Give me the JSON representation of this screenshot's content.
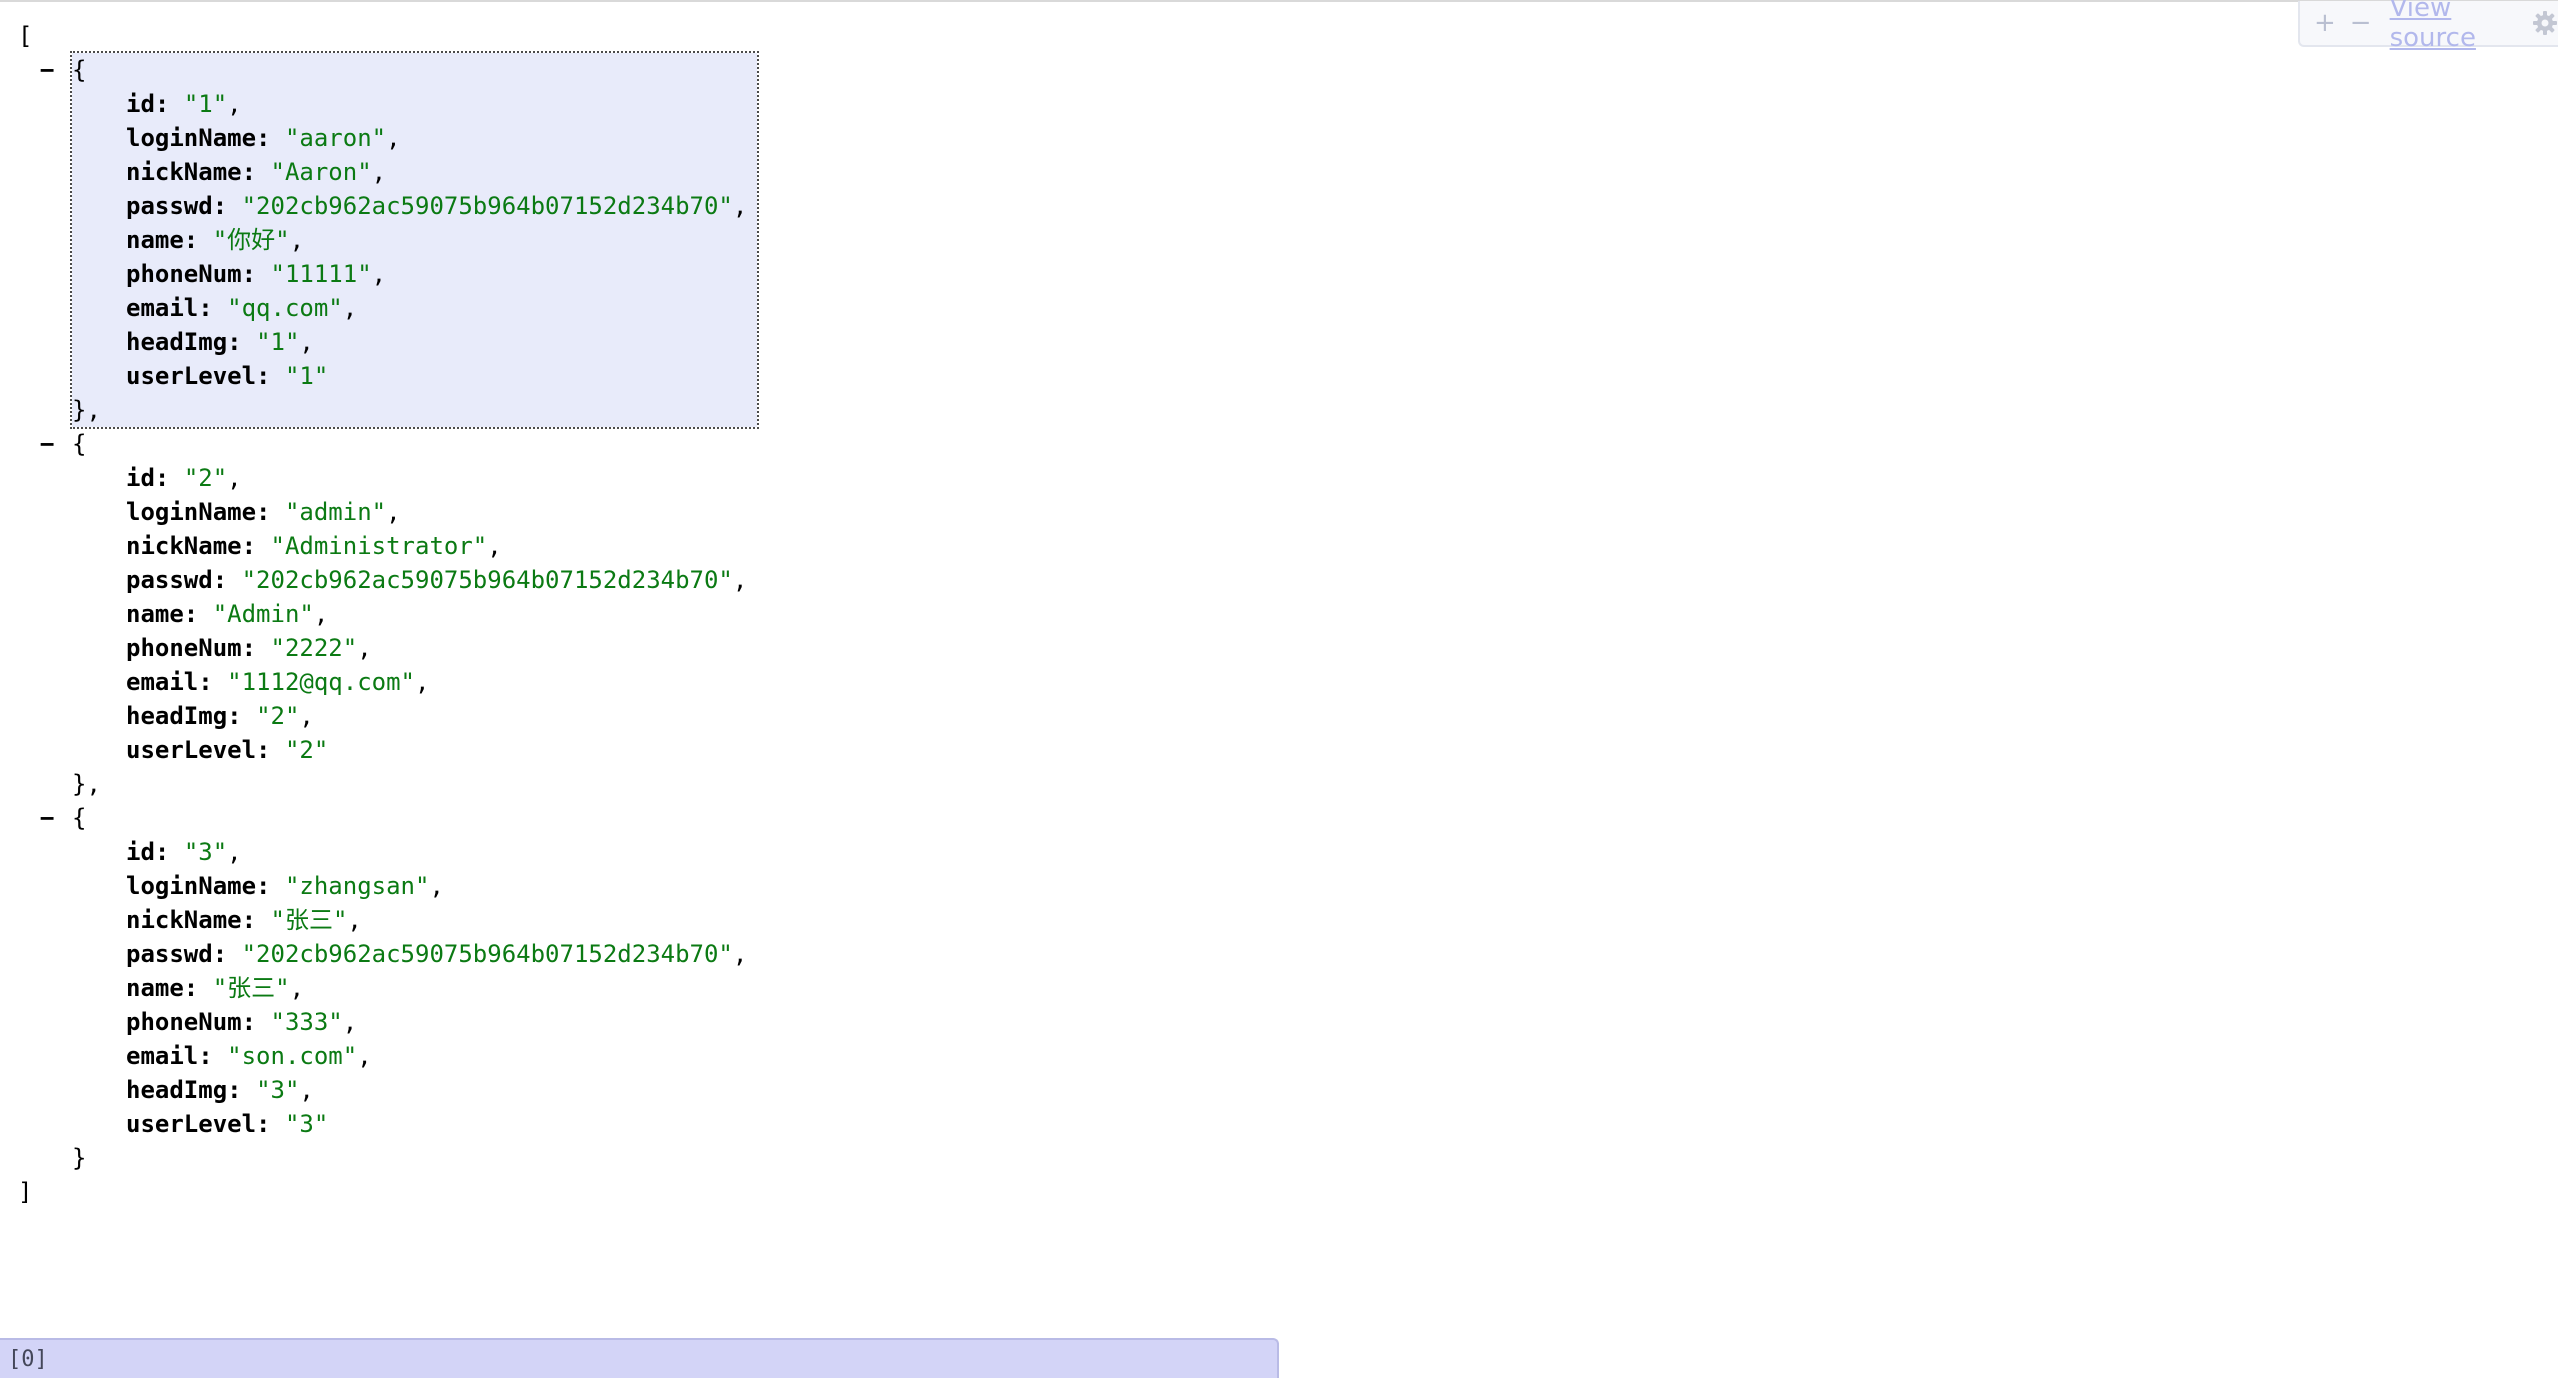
{
  "toolbar": {
    "expand_label": "+",
    "collapse_label": "−",
    "view_source_label": "View source",
    "gear_icon": "gear-icon"
  },
  "json": {
    "open_bracket": "[",
    "close_bracket": "]",
    "collapser": "−",
    "records": [
      {
        "id": "\"1\"",
        "loginName": "\"aaron\"",
        "nickName": "\"Aaron\"",
        "passwd": "\"202cb962ac59075b964b07152d234b70\"",
        "name": "\"你好\"",
        "phoneNum": "\"11111\"",
        "email": "\"qq.com\"",
        "headImg": "\"1\"",
        "userLevel": "\"1\""
      },
      {
        "id": "\"2\"",
        "loginName": "\"admin\"",
        "nickName": "\"Administrator\"",
        "passwd": "\"202cb962ac59075b964b07152d234b70\"",
        "name": "\"Admin\"",
        "phoneNum": "\"2222\"",
        "email": "\"1112@qq.com\"",
        "headImg": "\"2\"",
        "userLevel": "\"2\""
      },
      {
        "id": "\"3\"",
        "loginName": "\"zhangsan\"",
        "nickName": "\"张三\"",
        "passwd": "\"202cb962ac59075b964b07152d234b70\"",
        "name": "\"张三\"",
        "phoneNum": "\"333\"",
        "email": "\"son.com\"",
        "headImg": "\"3\"",
        "userLevel": "\"3\""
      }
    ]
  },
  "keys": {
    "id": "id",
    "loginName": "loginName",
    "nickName": "nickName",
    "passwd": "passwd",
    "name": "name",
    "phoneNum": "phoneNum",
    "email": "email",
    "headImg": "headImg",
    "userLevel": "userLevel"
  },
  "status": {
    "path": "[0]"
  },
  "colors": {
    "string": "#0b7a13",
    "highlight_bg": "#e8ebfa",
    "statusbar_bg": "#d3d4f7",
    "link": "#b2b8ec"
  }
}
